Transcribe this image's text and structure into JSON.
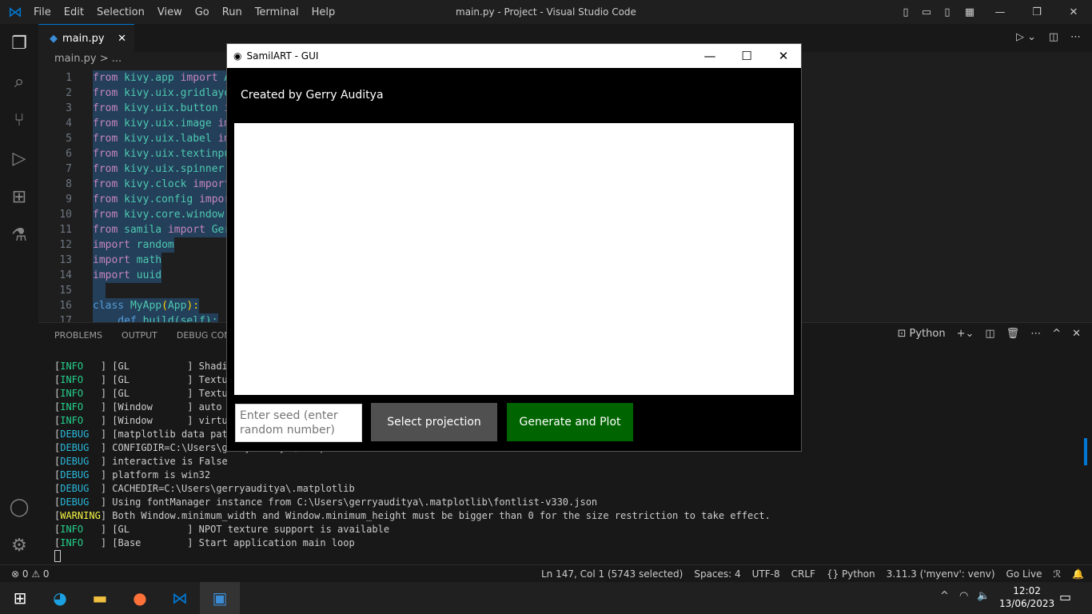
{
  "window": {
    "title": "main.py - Project - Visual Studio Code",
    "menu": [
      "File",
      "Edit",
      "Selection",
      "View",
      "Go",
      "Run",
      "Terminal",
      "Help"
    ]
  },
  "editor": {
    "tab": "main.py",
    "breadcrumb": "main.py > ...",
    "lines": [
      {
        "n": "1",
        "parts": [
          [
            "kw",
            "from"
          ],
          [
            "md",
            " kivy.app "
          ],
          [
            "kw",
            "import"
          ],
          [
            "md",
            " A"
          ]
        ]
      },
      {
        "n": "2",
        "parts": [
          [
            "kw",
            "from"
          ],
          [
            "md",
            " kivy.uix.gridlayo"
          ]
        ]
      },
      {
        "n": "3",
        "parts": [
          [
            "kw",
            "from"
          ],
          [
            "md",
            " kivy.uix.button "
          ],
          [
            "kw",
            "i"
          ]
        ]
      },
      {
        "n": "4",
        "parts": [
          [
            "kw",
            "from"
          ],
          [
            "md",
            " kivy.uix.image "
          ],
          [
            "kw",
            "im"
          ]
        ]
      },
      {
        "n": "5",
        "parts": [
          [
            "kw",
            "from"
          ],
          [
            "md",
            " kivy.uix.label "
          ],
          [
            "kw",
            "im"
          ]
        ]
      },
      {
        "n": "6",
        "parts": [
          [
            "kw",
            "from"
          ],
          [
            "md",
            " kivy.uix.textinpu"
          ]
        ]
      },
      {
        "n": "7",
        "parts": [
          [
            "kw",
            "from"
          ],
          [
            "md",
            " kivy.uix.spinner "
          ]
        ]
      },
      {
        "n": "8",
        "parts": [
          [
            "kw",
            "from"
          ],
          [
            "md",
            " kivy.clock "
          ],
          [
            "kw",
            "import"
          ]
        ]
      },
      {
        "n": "9",
        "parts": [
          [
            "kw",
            "from"
          ],
          [
            "md",
            " kivy.config "
          ],
          [
            "kw",
            "impor"
          ]
        ]
      },
      {
        "n": "10",
        "parts": [
          [
            "kw",
            "from"
          ],
          [
            "md",
            " kivy.core.window "
          ]
        ]
      },
      {
        "n": "11",
        "parts": [
          [
            "kw",
            "from"
          ],
          [
            "md",
            " samila "
          ],
          [
            "kw",
            "import"
          ],
          [
            "md",
            " Ger"
          ]
        ]
      },
      {
        "n": "12",
        "parts": [
          [
            "kw",
            "import"
          ],
          [
            "md",
            " random"
          ]
        ]
      },
      {
        "n": "13",
        "parts": [
          [
            "kw",
            "import"
          ],
          [
            "md",
            " math"
          ]
        ]
      },
      {
        "n": "14",
        "parts": [
          [
            "kw",
            "import"
          ],
          [
            "md",
            " uuid"
          ]
        ]
      },
      {
        "n": "15",
        "parts": [
          [
            "md",
            "  "
          ]
        ]
      },
      {
        "n": "16",
        "parts": [
          [
            "cls",
            "class"
          ],
          [
            "md",
            " MyApp"
          ],
          [
            "warn",
            "("
          ],
          [
            "md",
            "App"
          ],
          [
            "warn",
            "):"
          ]
        ]
      },
      {
        "n": "17",
        "parts": [
          [
            "cls",
            "    def"
          ],
          [
            "md",
            " build(self):"
          ]
        ]
      }
    ]
  },
  "panel": {
    "tabs": [
      "PROBLEMS",
      "OUTPUT",
      "DEBUG CONSOLE"
    ],
    "terminal_name": "Python"
  },
  "terminal": [
    {
      "lvl": "INFO   ",
      "cls": "info",
      "msg": " [GL          ] Shadin"
    },
    {
      "lvl": "INFO   ",
      "cls": "info",
      "msg": " [GL          ] Textur"
    },
    {
      "lvl": "INFO   ",
      "cls": "info",
      "msg": " [GL          ] Textur"
    },
    {
      "lvl": "INFO   ",
      "cls": "info",
      "msg": " [Window      ] auto a"
    },
    {
      "lvl": "INFO   ",
      "cls": "info",
      "msg": " [Window      ] virtua"
    },
    {
      "lvl": "DEBUG  ",
      "cls": "debug",
      "msg": " [matplotlib data path"
    },
    {
      "lvl": "DEBUG  ",
      "cls": "debug",
      "msg": " CONFIGDIR=C:\\Users\\gerryauditya\\.matplotlib"
    },
    {
      "lvl": "DEBUG  ",
      "cls": "debug",
      "msg": " interactive is False"
    },
    {
      "lvl": "DEBUG  ",
      "cls": "debug",
      "msg": " platform is win32"
    },
    {
      "lvl": "DEBUG  ",
      "cls": "debug",
      "msg": " CACHEDIR=C:\\Users\\gerryauditya\\.matplotlib"
    },
    {
      "lvl": "DEBUG  ",
      "cls": "debug",
      "msg": " Using fontManager instance from C:\\Users\\gerryauditya\\.matplotlib\\fontlist-v330.json"
    },
    {
      "lvl": "WARNING",
      "cls": "warn",
      "msg": " Both Window.minimum_width and Window.minimum_height must be bigger than 0 for the size restriction to take effect."
    },
    {
      "lvl": "INFO   ",
      "cls": "info",
      "msg": " [GL          ] NPOT texture support is available"
    },
    {
      "lvl": "INFO   ",
      "cls": "info",
      "msg": " [Base        ] Start application main loop"
    }
  ],
  "status": {
    "problems": "⊗ 0 ⚠ 0",
    "items": [
      "Ln 147, Col 1 (5743 selected)",
      "Spaces: 4",
      "UTF-8",
      "CRLF",
      "{} Python",
      "3.11.3 ('myenv': venv)",
      "Go Live"
    ]
  },
  "taskbar": {
    "time": "12:02",
    "date": "13/06/2023"
  },
  "kivy": {
    "title": "SamilART - GUI",
    "created": "Created by Gerry Auditya",
    "seed_placeholder": "Enter seed (enter random number)",
    "select": "Select projection",
    "generate": "Generate and Plot",
    "colors": {
      "select": "#505050",
      "generate": "#006400"
    }
  }
}
